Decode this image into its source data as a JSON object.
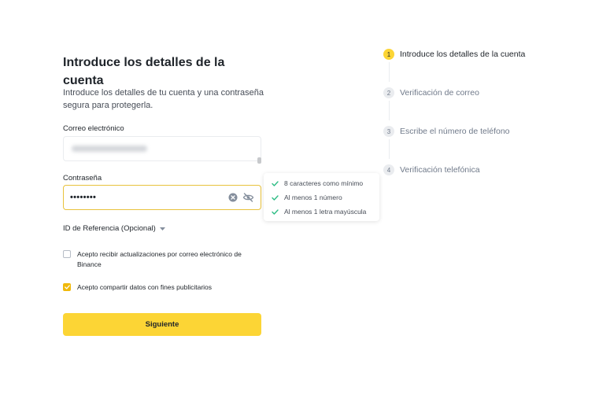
{
  "form": {
    "title": "Introduce los detalles de la cuenta",
    "subtitle": "Introduce los detalles de tu cuenta y una contraseña segura para protegerla.",
    "email_label": "Correo electrónico",
    "password_label": "Contraseña",
    "password_value": "••••••••",
    "referral_label": "ID de Referencia (Opcional)",
    "checkboxes": [
      {
        "label": "Acepto recibir actualizaciones por correo electrónico de Binance",
        "checked": false
      },
      {
        "label": "Acepto compartir datos con fines publicitarios",
        "checked": true
      }
    ],
    "submit_label": "Siguiente"
  },
  "password_rules": [
    {
      "text": "8 caracteres como mínimo",
      "met": true
    },
    {
      "text": "Al menos 1 número",
      "met": true
    },
    {
      "text": "Al menos 1 letra mayúscula",
      "met": true
    }
  ],
  "steps": [
    {
      "number": "1",
      "label": "Introduce los detalles de la cuenta",
      "active": true
    },
    {
      "number": "2",
      "label": "Verificación de correo",
      "active": false
    },
    {
      "number": "3",
      "label": "Escribe el número de teléfono",
      "active": false
    },
    {
      "number": "4",
      "label": "Verificación telefónica",
      "active": false
    }
  ],
  "icons": {
    "clear": "clear-icon",
    "visibility": "eye-off-icon",
    "check": "check-icon",
    "caret": "caret-down-icon"
  },
  "colors": {
    "accent": "#fcd535",
    "check_green": "#2ebd85",
    "focus_border": "#e8c23c"
  }
}
